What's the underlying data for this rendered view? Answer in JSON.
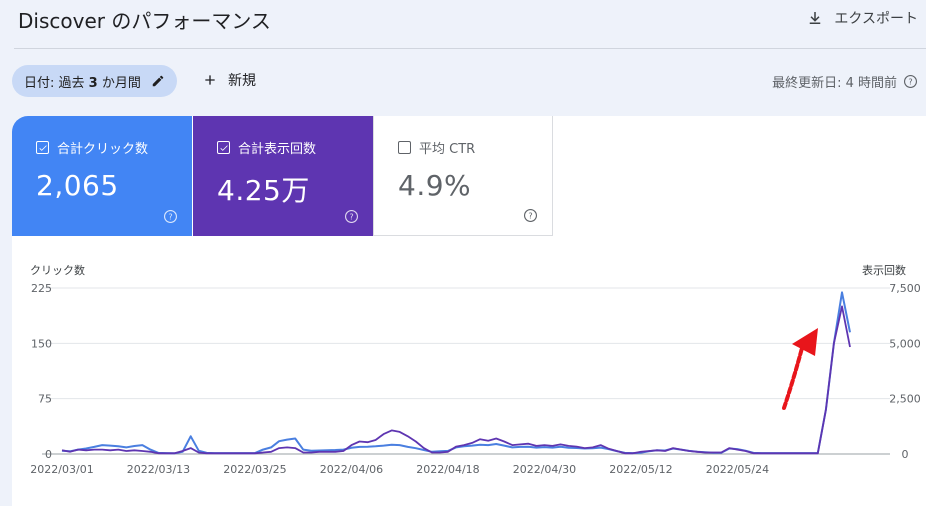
{
  "header": {
    "title": "Discover のパフォーマンス",
    "export_label": "エクスポート"
  },
  "filters": {
    "date_prefix": "日付: 過去 ",
    "date_bold": "3",
    "date_suffix": " か月間",
    "new_label": "新規",
    "last_updated": "最終更新日: 4 時間前"
  },
  "metrics": [
    {
      "label": "合計クリック数",
      "value": "2,065",
      "checked": true,
      "color": "#4285f4"
    },
    {
      "label": "合計表示回数",
      "value": "4.25万",
      "checked": true,
      "color": "#5e35b1"
    },
    {
      "label": "平均 CTR",
      "value": "4.9%",
      "checked": false,
      "color": "#ffffff"
    }
  ],
  "chart_data": {
    "type": "line",
    "y_left_label": "クリック数",
    "y_right_label": "表示回数",
    "y_left_ticks": [
      "225",
      "150",
      "75",
      "0"
    ],
    "y_right_ticks": [
      "7,500",
      "5,000",
      "2,500",
      "0"
    ],
    "ylim_left": [
      0,
      225
    ],
    "ylim_right": [
      0,
      7500
    ],
    "x_ticks": [
      "2022/03/01",
      "2022/03/13",
      "2022/03/25",
      "2022/04/06",
      "2022/04/18",
      "2022/04/30",
      "2022/05/12",
      "2022/05/24"
    ],
    "grid": true,
    "series": [
      {
        "name": "クリック数",
        "axis": "left",
        "color": "#5e35b1",
        "values": [
          5,
          3,
          6,
          5,
          6,
          6,
          5,
          6,
          4,
          5,
          4,
          3,
          1,
          1,
          1,
          4,
          8,
          2,
          1,
          1,
          1,
          1,
          1,
          1,
          1,
          2,
          3,
          8,
          9,
          8,
          2,
          2,
          3,
          3,
          3,
          4,
          12,
          17,
          16,
          19,
          27,
          32,
          30,
          24,
          17,
          8,
          2,
          2,
          3,
          10,
          12,
          15,
          20,
          18,
          21,
          17,
          12,
          13,
          14,
          11,
          12,
          11,
          13,
          11,
          10,
          8,
          9,
          12,
          7,
          4,
          1,
          1,
          3,
          4,
          5,
          4,
          8,
          6,
          4,
          3,
          2,
          2,
          2,
          8,
          6,
          4,
          1,
          1,
          1,
          1,
          1,
          1,
          1,
          1,
          1,
          60,
          150,
          200,
          145
        ]
      },
      {
        "name": "表示回数",
        "axis": "right",
        "color": "#4a7fe0",
        "values": [
          150,
          120,
          200,
          250,
          320,
          400,
          380,
          350,
          300,
          360,
          400,
          200,
          50,
          40,
          30,
          100,
          800,
          150,
          50,
          40,
          40,
          40,
          40,
          40,
          40,
          200,
          300,
          580,
          650,
          700,
          200,
          150,
          160,
          170,
          180,
          200,
          280,
          320,
          330,
          350,
          380,
          420,
          400,
          320,
          260,
          180,
          100,
          120,
          140,
          300,
          350,
          380,
          420,
          400,
          450,
          380,
          300,
          320,
          330,
          290,
          310,
          290,
          330,
          280,
          270,
          250,
          260,
          290,
          220,
          130,
          50,
          40,
          60,
          120,
          170,
          160,
          250,
          200,
          140,
          100,
          80,
          60,
          60,
          250,
          220,
          150,
          50,
          40,
          40,
          40,
          40,
          40,
          40,
          40,
          40,
          2000,
          5000,
          7300,
          5500
        ]
      }
    ]
  }
}
